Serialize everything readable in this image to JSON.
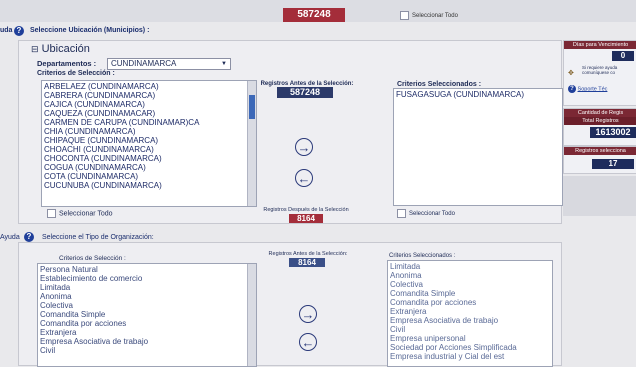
{
  "top": {
    "counter": "587248",
    "select_all": "Seleccionar Todo"
  },
  "section1": {
    "help_label": "uda",
    "title": "Seleccione Ubicación (Municipios) :"
  },
  "ubicacion": {
    "heading": "Ubicación",
    "dept_label": "Departamentos :",
    "dept_value": "CUNDINAMARCA",
    "criteria_label": "Criterios de Selección :",
    "municipios": [
      "ARBELAEZ (CUNDINAMARCA)",
      "CABRERA (CUNDINAMARCA)",
      "CAJICA (CUNDINAMARCA)",
      "CAQUEZA (CUNDINAMACAR)",
      "CARMEN DE CARUPA (CUNDINAMAR)CA",
      "CHIA (CUNDINAMARCA)",
      "CHIPAQUE (CUNDINAMARCA)",
      "CHOACHI (CUNDINAMARCA)",
      "CHOCONTA (CUNDINAMARCA)",
      "COGUA (CUNDINAMARCA)",
      "COTA (CUNDINAMARCA)",
      "CUCUNUBA (CUNDINAMARCA)"
    ],
    "select_all_left": "Seleccionar Todo",
    "before_label": "Registros Antes de la Selección:",
    "before_value": "587248",
    "after_label": "Registros Después de la Selección",
    "after_value": "8164",
    "selected_label": "Criterios Seleccionados :",
    "selected_items": [
      "FUSAGASUGA (CUNDINAMARCA)"
    ],
    "select_all_right": "Seleccionar Todo",
    "add_icon": "circle-arrow-right",
    "remove_icon": "circle-arrow-left"
  },
  "section2": {
    "help_label": "Ayuda",
    "title": "Seleccione el Tipo de Organización:",
    "criteria_label": "Criterios de Selección :",
    "items": [
      "Persona Natural",
      "Establecimiento de comercio",
      "Limitada",
      "Anonima",
      "Colectiva",
      "Comandita Simple",
      "Comandita por acciones",
      "Extranjera",
      "Empresa Asociativa de trabajo",
      "Civil"
    ],
    "before_label": "Registros Antes de la Selección:",
    "before_value": "8164",
    "selected_label": "Criterios Seleccionados :",
    "selected_items": [
      "Limitada",
      "Anonima",
      "Colectiva",
      "Comandita Simple",
      "Comandita por acciones",
      "Extranjera",
      "Empresa Asociativa de trabajo",
      "Civil",
      "Empresa unipersonal",
      "Sociedad por Acciones Simplificada",
      "Empresa industrial y Cial del est"
    ]
  },
  "sidebar": {
    "days_label": "Días para Vencimiento",
    "days_value": "0",
    "note": "Si requiere ayuda comuníquese co",
    "support_link": "Soporte Téc",
    "qty_label": "Cantidad de Regis",
    "total_label": "Total Registros",
    "total_value": "1613002",
    "selected_label": "Registros selecciona",
    "selected_value": "17"
  }
}
